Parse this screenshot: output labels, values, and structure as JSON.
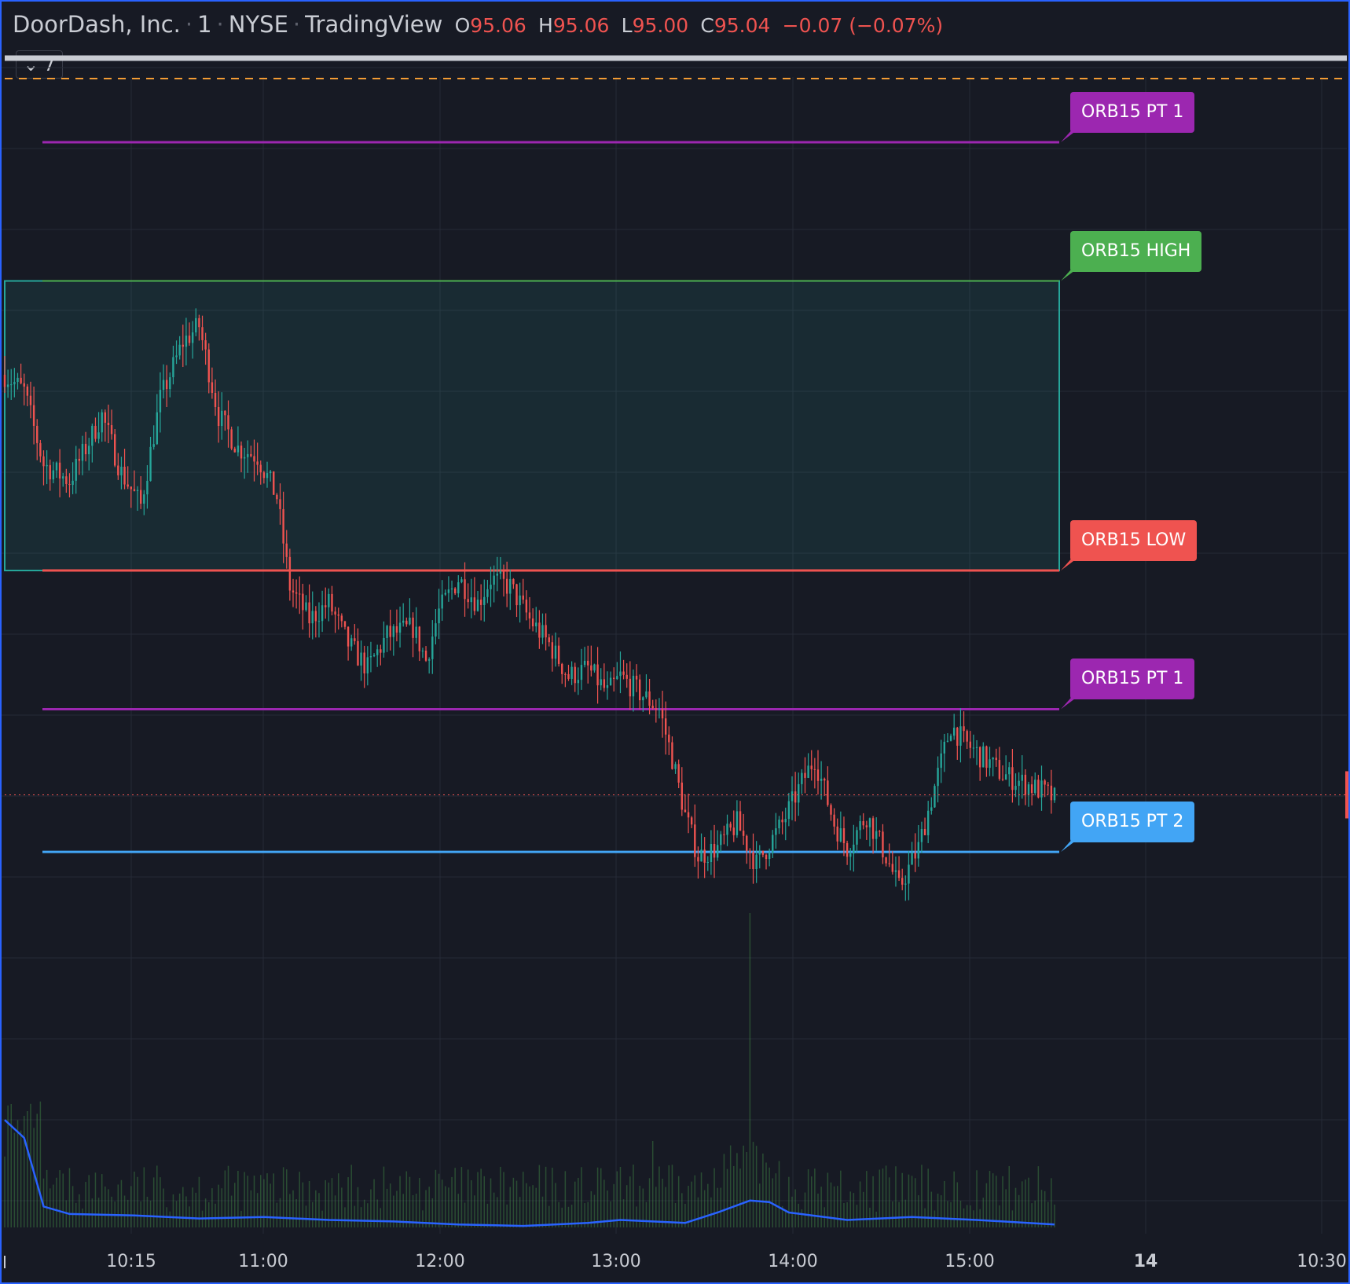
{
  "header": {
    "symbol": "DoorDash, Inc.",
    "interval": "1",
    "exchange": "NYSE",
    "source": "TradingView",
    "o_label": "O",
    "o_value": "95.06",
    "h_label": "H",
    "h_value": "95.06",
    "l_label": "L",
    "l_value": "95.00",
    "c_label": "C",
    "c_value": "95.04",
    "change": "−0.07 (−0.07%)"
  },
  "indicator_toggle": {
    "count": "7"
  },
  "colors": {
    "background": "#171a24",
    "grid": "#262a36",
    "up": "#26a69a",
    "down": "#ef5350",
    "orb_high": "#4caf50",
    "orb_low": "#ef5350",
    "pt1": "#9c27b0",
    "pt2": "#42a5f5",
    "volume_ma": "#2962ff"
  },
  "chart_data": {
    "type": "candlestick",
    "x_ticks": [
      "10:15",
      "11:00",
      "12:00",
      "13:00",
      "14:00",
      "15:00",
      "14",
      "10:30"
    ],
    "levels": [
      {
        "label": "ORB15 PT 1",
        "kind": "pt1",
        "y": 1.79
      },
      {
        "label": "ORB15 HIGH",
        "kind": "high",
        "y": 1.45
      },
      {
        "label": "ORB15 LOW",
        "kind": "low",
        "y": 0.74
      },
      {
        "label": "ORB15 PT 1",
        "kind": "pt1",
        "y": 0.4
      },
      {
        "label": "ORB15 PT 2",
        "kind": "pt2",
        "y": 0.05
      }
    ],
    "y_range": [
      -0.1,
      1.95
    ],
    "last_price_y": 0.19,
    "price_path": [
      [
        0,
        1.22
      ],
      [
        6,
        1.18
      ],
      [
        12,
        1.0
      ],
      [
        20,
        0.96
      ],
      [
        30,
        1.12
      ],
      [
        36,
        0.98
      ],
      [
        42,
        0.9
      ],
      [
        48,
        1.16
      ],
      [
        55,
        1.3
      ],
      [
        60,
        1.34
      ],
      [
        66,
        1.12
      ],
      [
        72,
        1.04
      ],
      [
        78,
        1.02
      ],
      [
        84,
        0.92
      ],
      [
        88,
        0.7
      ],
      [
        94,
        0.62
      ],
      [
        100,
        0.66
      ],
      [
        106,
        0.56
      ],
      [
        112,
        0.5
      ],
      [
        118,
        0.58
      ],
      [
        126,
        0.6
      ],
      [
        130,
        0.52
      ],
      [
        134,
        0.64
      ],
      [
        140,
        0.72
      ],
      [
        146,
        0.66
      ],
      [
        150,
        0.72
      ],
      [
        156,
        0.7
      ],
      [
        162,
        0.62
      ],
      [
        168,
        0.56
      ],
      [
        174,
        0.48
      ],
      [
        180,
        0.5
      ],
      [
        186,
        0.44
      ],
      [
        190,
        0.48
      ],
      [
        196,
        0.44
      ],
      [
        202,
        0.4
      ],
      [
        206,
        0.28
      ],
      [
        210,
        0.14
      ],
      [
        214,
        0.04
      ],
      [
        220,
        0.06
      ],
      [
        226,
        0.12
      ],
      [
        232,
        0.02
      ],
      [
        240,
        0.12
      ],
      [
        246,
        0.22
      ],
      [
        250,
        0.28
      ],
      [
        256,
        0.12
      ],
      [
        260,
        0.06
      ],
      [
        266,
        0.14
      ],
      [
        272,
        0.04
      ],
      [
        276,
        -0.04
      ],
      [
        282,
        0.06
      ],
      [
        286,
        0.18
      ],
      [
        292,
        0.36
      ],
      [
        296,
        0.32
      ],
      [
        302,
        0.28
      ],
      [
        308,
        0.24
      ],
      [
        314,
        0.22
      ],
      [
        320,
        0.2
      ],
      [
        324,
        0.18
      ]
    ],
    "volume_path": [
      [
        0,
        0.72
      ],
      [
        6,
        0.6
      ],
      [
        12,
        0.14
      ],
      [
        20,
        0.09
      ],
      [
        40,
        0.08
      ],
      [
        60,
        0.06
      ],
      [
        80,
        0.07
      ],
      [
        100,
        0.05
      ],
      [
        120,
        0.04
      ],
      [
        140,
        0.02
      ],
      [
        160,
        0.01
      ],
      [
        180,
        0.03
      ],
      [
        190,
        0.05
      ],
      [
        210,
        0.03
      ],
      [
        220,
        0.1
      ],
      [
        230,
        0.18
      ],
      [
        236,
        0.17
      ],
      [
        242,
        0.1
      ],
      [
        260,
        0.05
      ],
      [
        280,
        0.07
      ],
      [
        300,
        0.05
      ],
      [
        324,
        0.02
      ]
    ]
  }
}
